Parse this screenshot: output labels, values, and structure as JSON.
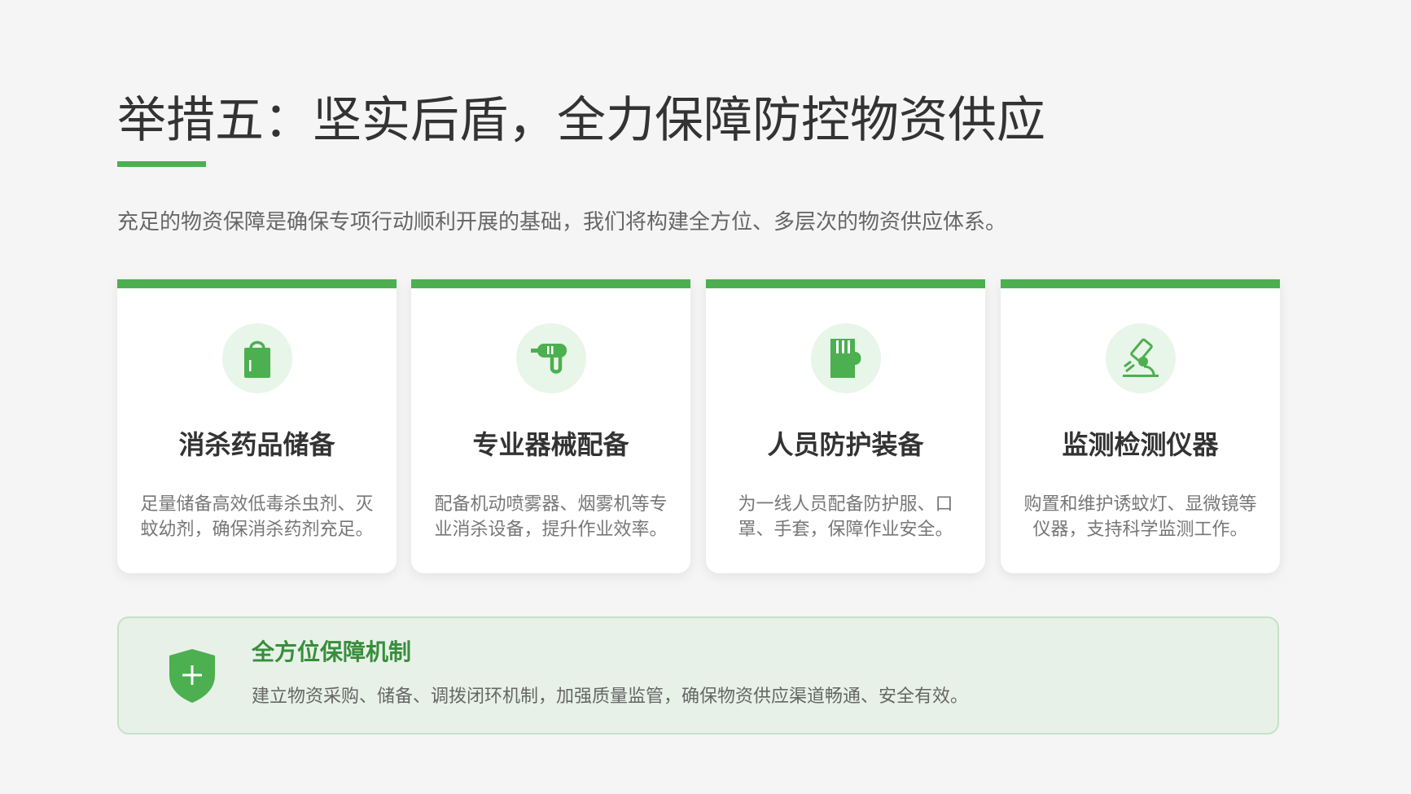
{
  "title": "举措五：坚实后盾，全力保障防控物资供应",
  "intro": "充足的物资保障是确保专项行动顺利开展的基础，我们将构建全方位、多层次的物资供应体系。",
  "colors": {
    "accent": "#4caf50",
    "accent_light": "#e8f5e9",
    "banner_title": "#388e3c"
  },
  "cards": [
    {
      "icon": "shopping-bag-icon",
      "title": "消杀药品储备",
      "desc": "足量储备高效低毒杀虫剂、灭蚊幼剂，确保消杀药剂充足。"
    },
    {
      "icon": "spray-gun-icon",
      "title": "专业器械配备",
      "desc": "配备机动喷雾器、烟雾机等专业消杀设备，提升作业效率。"
    },
    {
      "icon": "glove-icon",
      "title": "人员防护装备",
      "desc": "为一线人员配备防护服、口罩、手套，保障作业安全。"
    },
    {
      "icon": "microscope-icon",
      "title": "监测检测仪器",
      "desc": "购置和维护诱蚊灯、显微镜等仪器，支持科学监测工作。"
    }
  ],
  "banner": {
    "icon": "shield-plus-icon",
    "title": "全方位保障机制",
    "desc": "建立物资采购、储备、调拨闭环机制，加强质量监管，确保物资供应渠道畅通、安全有效。"
  }
}
